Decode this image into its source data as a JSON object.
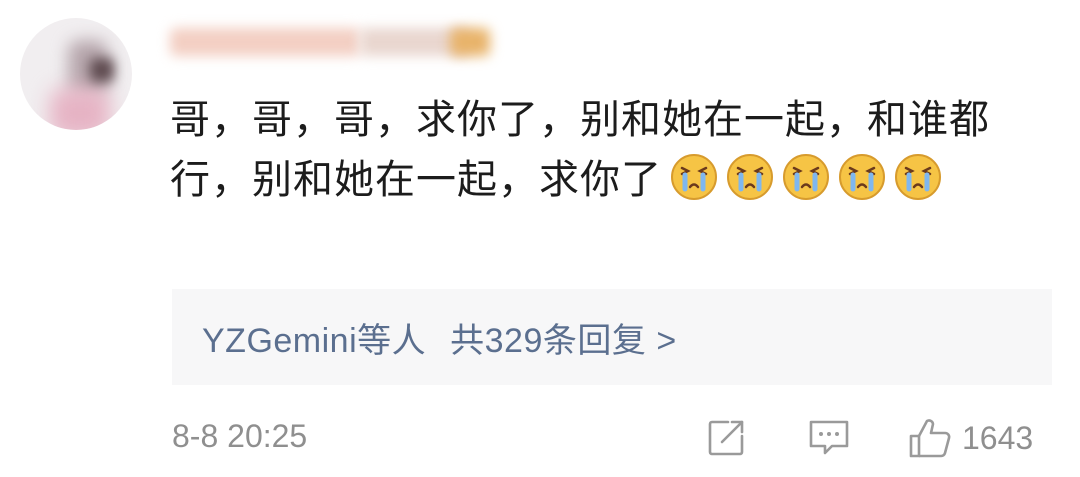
{
  "comment": {
    "text": "哥，哥，哥，求你了，别和她在一起，和谁都行，别和她在一起，求你了",
    "emojis": [
      "crying-emoji",
      "crying-emoji",
      "crying-emoji",
      "crying-emoji",
      "crying-emoji"
    ]
  },
  "replies": {
    "summary": "YZGemini等人",
    "count_text": "共329条回复 >"
  },
  "footer": {
    "timestamp": "8-8 20:25",
    "like_count": "1643"
  },
  "icons": {
    "share": "share-icon",
    "comment": "comment-icon",
    "like": "thumbs-up-icon"
  },
  "colors": {
    "comment_text": "#1c1c1c",
    "reply_link": "#5b6f8f",
    "meta_text": "#8f8f8f",
    "reply_bg": "#f7f7f8"
  }
}
